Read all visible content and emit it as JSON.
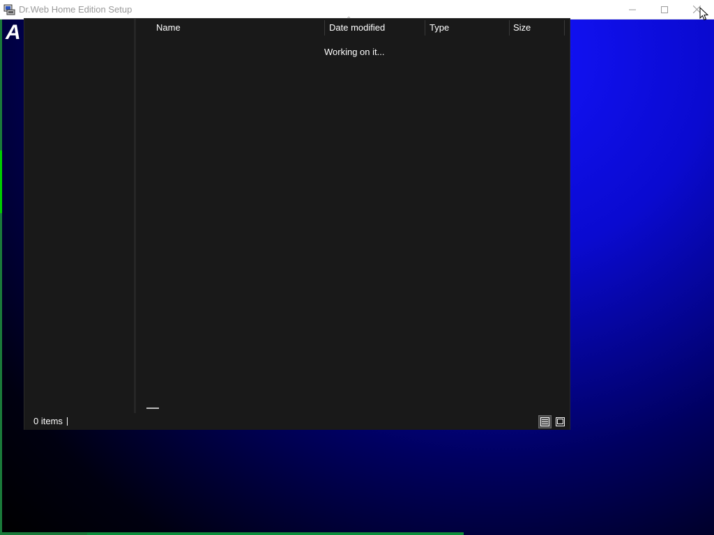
{
  "window": {
    "title": "Dr.Web Home Edition Setup",
    "title_icon": "installer-icon",
    "controls": {
      "minimize_icon": "minimize-icon",
      "maximize_icon": "maximize-icon",
      "close_icon": "close-icon"
    }
  },
  "background": {
    "logo_text": "A",
    "accent_color": "#0a0ad0"
  },
  "dialog": {
    "columns": [
      {
        "label": "Name"
      },
      {
        "label": "Date modified"
      },
      {
        "label": "Type"
      },
      {
        "label": "Size"
      }
    ],
    "sort_icon": "sort-up-icon",
    "loading_text": "Working on it...",
    "status": {
      "items_count": "0 items"
    },
    "view_buttons": {
      "details_icon": "details-view-icon",
      "large_icon": "large-icons-view-icon"
    }
  }
}
